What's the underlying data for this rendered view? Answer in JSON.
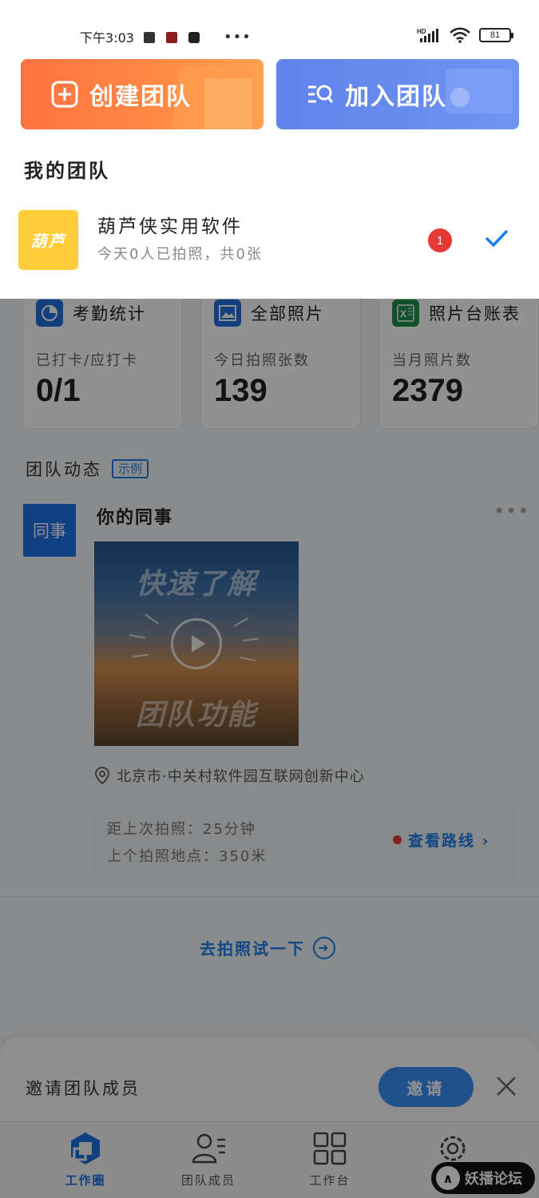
{
  "status_bar": {
    "time": "下午3:03",
    "more": "•••",
    "network": "HD",
    "battery": "81"
  },
  "actions": {
    "create_team": "创建团队",
    "join_team": "加入团队"
  },
  "my_teams": {
    "title": "我的团队",
    "team": {
      "avatar_text": "葫芦",
      "name": "葫芦侠实用软件",
      "subtitle": "今天0人已拍照，共0张",
      "badge": "1"
    }
  },
  "stats": [
    {
      "icon": "pie-chart-icon",
      "color": "#1e6fe0",
      "title": "考勤统计",
      "sub": "已打卡/应打卡",
      "value": "0/1"
    },
    {
      "icon": "image-icon",
      "color": "#1e6fe0",
      "title": "全部照片",
      "sub": "今日拍照张数",
      "value": "139"
    },
    {
      "icon": "excel-icon",
      "color": "#1d8f4a",
      "title": "照片台账表",
      "sub": "当月照片数",
      "value": "2379"
    }
  ],
  "feed": {
    "title": "团队动态",
    "badge": "示例",
    "avatar_text": "同事",
    "poster": "你的同事",
    "more": "•••",
    "video_top": "快速了解",
    "video_bottom": "团队功能",
    "location": "北京市·中关村软件园互联网创新中心",
    "last_photo": "距上次拍照：25分钟",
    "last_place": "上个拍照地点：350米",
    "route_link": "查看路线 ›"
  },
  "try_link": "去拍照试一下",
  "invite": {
    "text": "邀请团队成员",
    "button": "邀请"
  },
  "nav": [
    {
      "label": "工作圈",
      "icon": "work-circle-icon",
      "active": true
    },
    {
      "label": "团队成员",
      "icon": "team-members-icon",
      "active": false
    },
    {
      "label": "工作台",
      "icon": "workbench-grid-icon",
      "active": false
    },
    {
      "label": "",
      "icon": "settings-gear-icon",
      "active": false
    }
  ],
  "watermark": {
    "logo": "∧",
    "text": "妖播论坛"
  }
}
